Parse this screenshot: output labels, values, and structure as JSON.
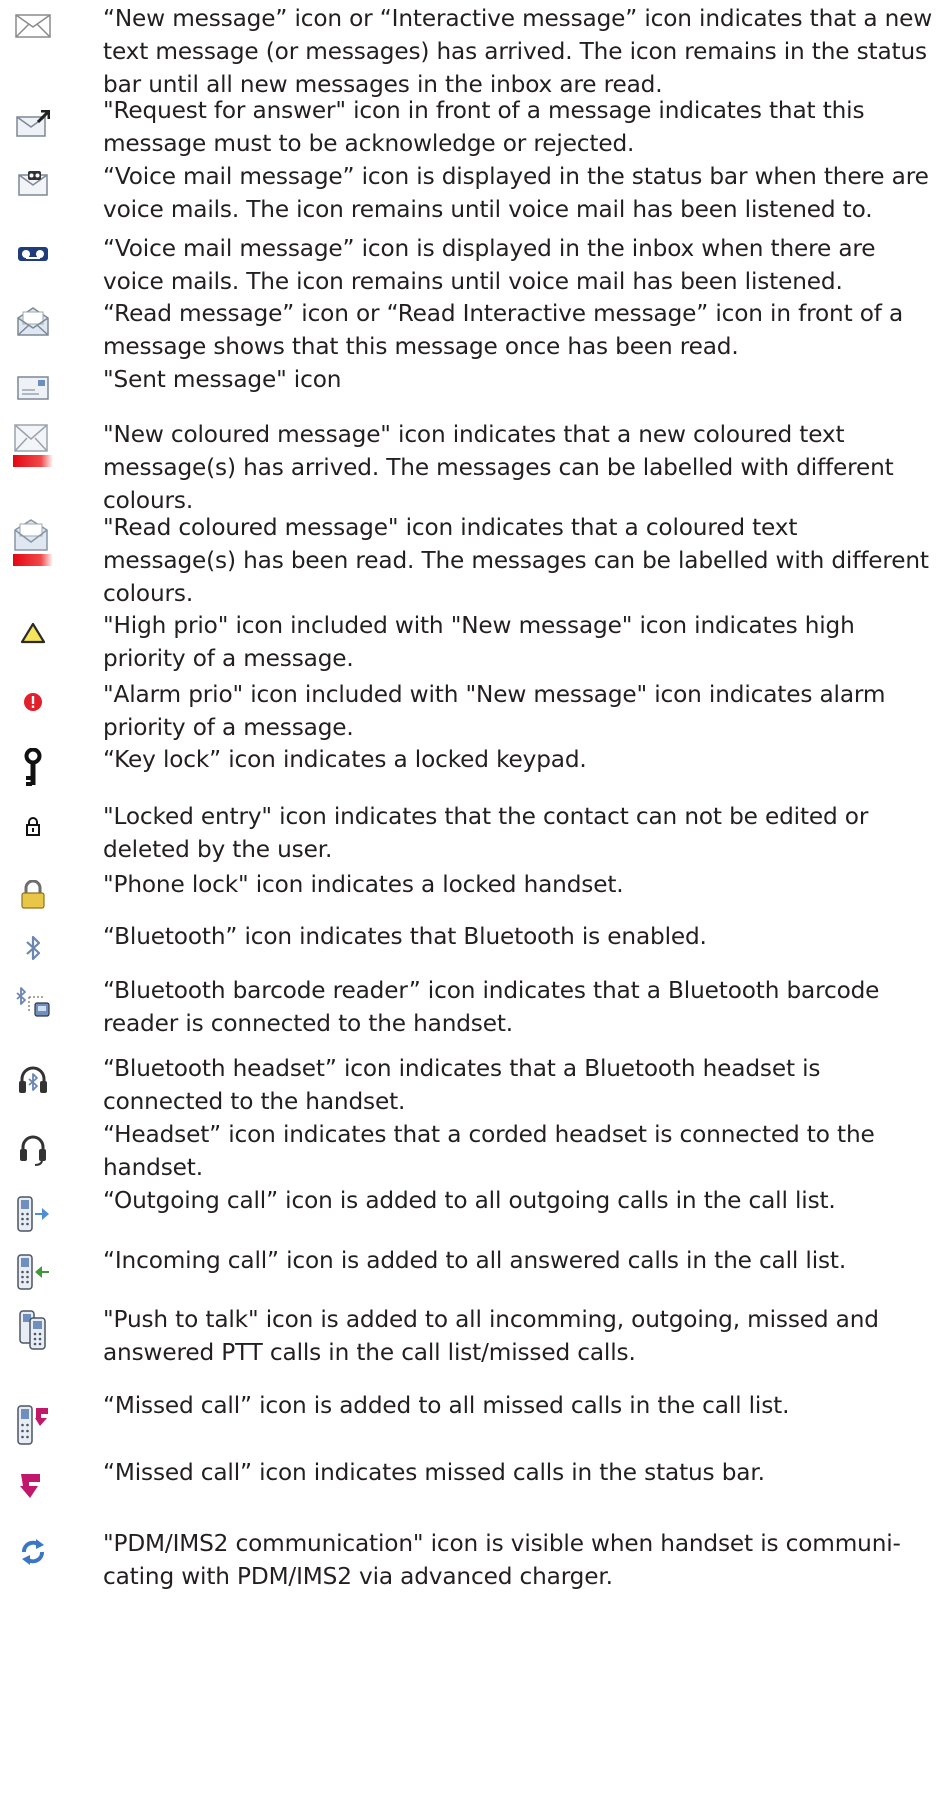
{
  "entries": [
    {
      "icon": "envelope-icon",
      "text": "“New message” icon or “Interactive message” icon indicates that a new text message (or messages) has arrived. The icon remains in the status bar until all new messages in the inbox are read."
    },
    {
      "icon": "request-answer-envelope-icon",
      "text": "\"Request for answer\" icon in front of a message indicates that this message must to be acknowledge or rejected."
    },
    {
      "icon": "voicemail-envelope-icon",
      "text": "“Voice mail message” icon is displayed in the status bar when there are voice mails. The icon remains until voice mail has been listened to."
    },
    {
      "icon": "voicemail-tape-icon",
      "text": "“Voice mail message” icon is displayed in the inbox when there are voice mails. The icon remains until voice mail has been listened."
    },
    {
      "icon": "read-envelope-icon",
      "text": "“Read message” icon or “Read Interactive message” icon in front of a message shows that this message once has been read."
    },
    {
      "icon": "sent-message-icon",
      "text": "\"Sent message\" icon"
    },
    {
      "icon": "new-coloured-envelope-icon",
      "text": "\"New coloured message\" icon indicates that a new coloured text message(s) has arrived. The messages can be labelled with different colours."
    },
    {
      "icon": "read-coloured-envelope-icon",
      "text": "\"Read coloured message\" icon indicates that a coloured text message(s) has been read. The messages can be labelled with different colours."
    },
    {
      "icon": "warning-triangle-icon",
      "text": "\"High prio\" icon included with \"New message\" icon indicates high priority of a message."
    },
    {
      "icon": "alarm-circle-icon",
      "text": "\"Alarm prio\" icon included with \"New message\" icon indicates alarm priority of a message."
    },
    {
      "icon": "key-icon",
      "text": "“Key lock” icon indicates a locked keypad."
    },
    {
      "icon": "small-lock-icon",
      "text": "\"Locked entry\" icon indicates that the contact can not be edited or deleted by the user."
    },
    {
      "icon": "padlock-icon",
      "text": "\"Phone lock\" icon indicates a locked handset."
    },
    {
      "icon": "bluetooth-icon",
      "text": "“Bluetooth” icon indicates that Bluetooth is enabled."
    },
    {
      "icon": "bluetooth-barcode-icon",
      "text": "“Bluetooth barcode reader” icon indicates that a Bluetooth barcode reader is connected to the handset."
    },
    {
      "icon": "bluetooth-headset-icon",
      "text": "“Bluetooth headset” icon indicates that a Bluetooth headset is connected to the handset."
    },
    {
      "icon": "headset-icon",
      "text": "“Headset” icon indicates that a corded headset is connected to the handset."
    },
    {
      "icon": "outgoing-call-icon",
      "text": "“Outgoing call” icon is added to all outgoing calls in the call list."
    },
    {
      "icon": "incoming-call-icon",
      "text": "“Incoming call” icon is added to all answered calls in the call list."
    },
    {
      "icon": "push-to-talk-icon",
      "text": "\"Push to talk\" icon is added to all incomming, outgoing, missed and answered PTT calls in the call list/missed calls."
    },
    {
      "icon": "missed-call-phone-icon",
      "text": "“Missed call” icon is added to all missed calls in the call list."
    },
    {
      "icon": "missed-call-arrow-icon",
      "text": "“Missed call” icon indicates missed calls in the status bar."
    },
    {
      "icon": "sync-arrows-icon",
      "text": "\"PDM/IMS2 communication\" icon is visible when handset is communi-cating with PDM/IMS2 via advanced charger."
    }
  ]
}
